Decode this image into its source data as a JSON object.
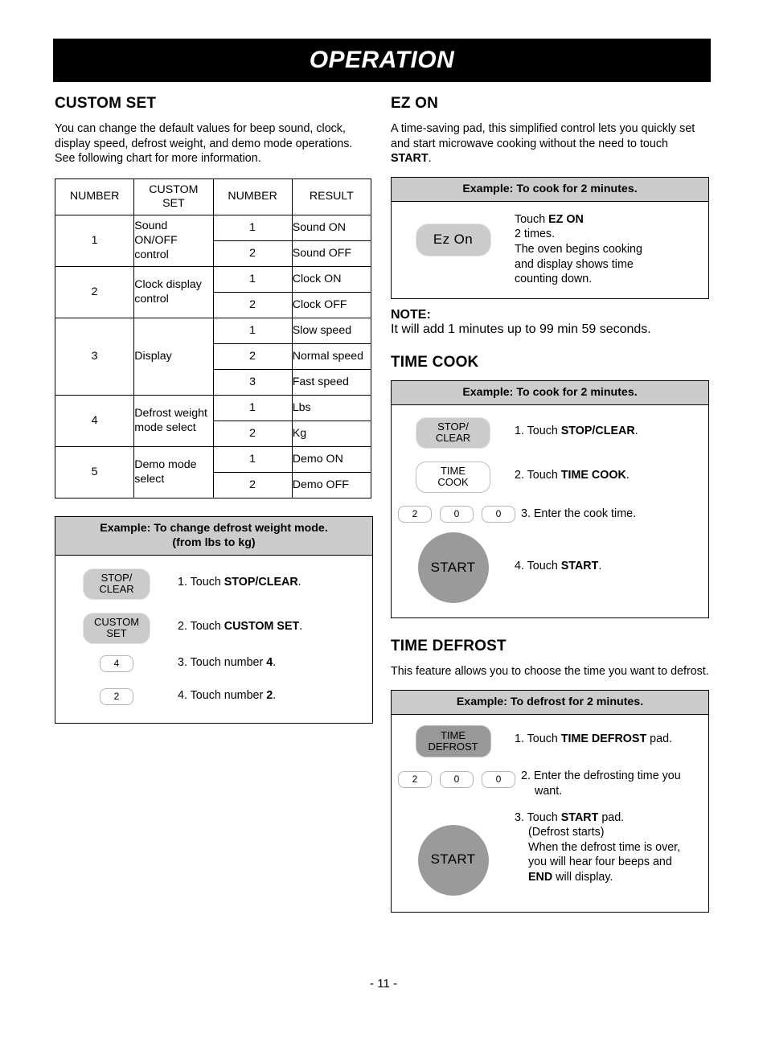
{
  "banner": {
    "title": "OPERATION"
  },
  "footer": {
    "page_number": "- 11 -"
  },
  "left_column": {
    "custom_set": {
      "heading": "CUSTOM SET",
      "intro_line1": "You can change the default values for beep sound, clock, display speed, defrost weight, and demo mode operations.",
      "intro_line2": "See following chart for more information.",
      "table": {
        "headers": [
          "NUMBER",
          "CUSTOM SET",
          "NUMBER",
          "RESULT"
        ],
        "groups": [
          {
            "number": "1",
            "custom_set": "Sound ON/OFF control",
            "rows": [
              {
                "number": "1",
                "result": "Sound ON"
              },
              {
                "number": "2",
                "result": "Sound OFF"
              }
            ]
          },
          {
            "number": "2",
            "custom_set": "Clock display control",
            "rows": [
              {
                "number": "1",
                "result": "Clock ON"
              },
              {
                "number": "2",
                "result": "Clock OFF"
              }
            ]
          },
          {
            "number": "3",
            "custom_set": "Display",
            "rows": [
              {
                "number": "1",
                "result": "Slow speed"
              },
              {
                "number": "2",
                "result": "Normal speed"
              },
              {
                "number": "3",
                "result": "Fast speed"
              }
            ]
          },
          {
            "number": "4",
            "custom_set": "Defrost weight mode select",
            "rows": [
              {
                "number": "1",
                "result": "Lbs"
              },
              {
                "number": "2",
                "result": "Kg"
              }
            ]
          },
          {
            "number": "5",
            "custom_set": "Demo mode select",
            "rows": [
              {
                "number": "1",
                "result": "Demo ON"
              },
              {
                "number": "2",
                "result": "Demo OFF"
              }
            ]
          }
        ]
      },
      "example": {
        "header_line1": "Example: To change defrost weight mode.",
        "header_line2": "(from lbs to kg)",
        "steps": [
          {
            "pad_type": "gray",
            "pad_label_line1": "STOP/",
            "pad_label_line2": "CLEAR",
            "prefix": "1. Touch ",
            "bold": "STOP/CLEAR",
            "suffix": "."
          },
          {
            "pad_type": "gray",
            "pad_label_line1": "CUSTOM",
            "pad_label_line2": "SET",
            "prefix": "2. Touch ",
            "bold": "CUSTOM SET",
            "suffix": "."
          },
          {
            "pad_type": "number",
            "pad_label_line1": "4",
            "pad_label_line2": "",
            "prefix": "3. Touch number ",
            "bold": "4",
            "suffix": "."
          },
          {
            "pad_type": "number",
            "pad_label_line1": "2",
            "pad_label_line2": "",
            "prefix": "4. Touch number ",
            "bold": "2",
            "suffix": "."
          }
        ]
      }
    }
  },
  "right_column": {
    "ez_on": {
      "heading": "EZ ON",
      "intro_prefix": "A time-saving pad, this simplified control lets you quickly set and start microwave cooking without the need to touch ",
      "intro_bold": "START",
      "intro_suffix": ".",
      "example": {
        "header": "Example: To cook for 2 minutes.",
        "pad_label": "Ez On",
        "text_line1_prefix": "Touch ",
        "text_line1_bold": "EZ ON",
        "text_line2": "2 times.",
        "text_line3": "The oven begins cooking",
        "text_line4": "and display shows time",
        "text_line5": "counting down."
      },
      "note_label": "NOTE:",
      "note_text": "It will add 1 minutes up to 99 min 59 seconds."
    },
    "time_cook": {
      "heading": "TIME COOK",
      "example": {
        "header": "Example: To cook for 2 minutes.",
        "steps": [
          {
            "pad_type": "gray",
            "pad_label_line1": "STOP/",
            "pad_label_line2": "CLEAR",
            "prefix": "1. Touch ",
            "bold": "STOP/CLEAR",
            "suffix": "."
          },
          {
            "pad_type": "white",
            "pad_label_line1": "TIME",
            "pad_label_line2": "COOK",
            "prefix": "2. Touch ",
            "bold": "TIME COOK",
            "suffix": "."
          },
          {
            "pad_type": "numbers",
            "numbers": [
              "2",
              "0",
              "0"
            ],
            "prefix": "3. Enter the cook time.",
            "bold": "",
            "suffix": ""
          },
          {
            "pad_type": "circle",
            "pad_label_line1": "START",
            "pad_label_line2": "",
            "prefix": "4. Touch ",
            "bold": "START",
            "suffix": "."
          }
        ]
      }
    },
    "time_defrost": {
      "heading": "TIME DEFROST",
      "intro": "This feature allows you to choose the time you want to defrost.",
      "example": {
        "header": "Example: To defrost for 2 minutes.",
        "step1": {
          "pad_label_line1": "TIME",
          "pad_label_line2": "DEFROST",
          "prefix": "1. Touch ",
          "bold": "TIME DEFROST",
          "suffix": " pad."
        },
        "step2": {
          "numbers": [
            "2",
            "0",
            "0"
          ],
          "line1": "2. Enter the defrosting time you",
          "line2": "want."
        },
        "step3": {
          "pad_label": "START",
          "line1_prefix": "3. Touch ",
          "line1_bold": "START",
          "line1_suffix": " pad.",
          "line2": "(Defrost starts)",
          "line3": "When the defrost time is over,",
          "line4": "you will hear four beeps and",
          "line5_bold": "END",
          "line5_suffix": " will display."
        }
      }
    }
  }
}
